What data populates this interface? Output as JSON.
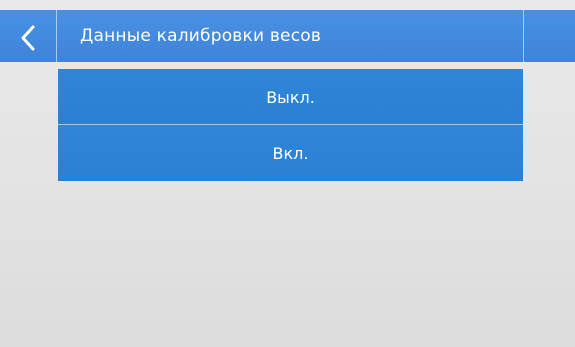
{
  "header": {
    "title": "Данные калибровки весов",
    "back_icon": "chevron-left-icon"
  },
  "options": [
    {
      "label": "Выкл."
    },
    {
      "label": "Вкл."
    }
  ],
  "colors": {
    "header": "#4a90e2",
    "option": "#2f86d9",
    "background": "#e6e6e6",
    "text": "#ffffff"
  }
}
